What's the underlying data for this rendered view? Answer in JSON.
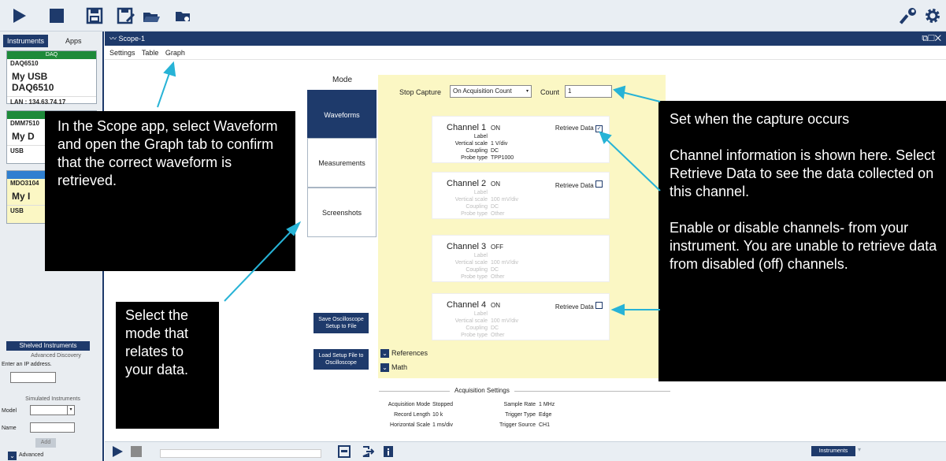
{
  "toolbar": {
    "icons": [
      "run-icon",
      "stop-icon",
      "save-icon",
      "save-as-icon",
      "open-icon",
      "open-folder-icon",
      "wrench-icon",
      "settings-gear-icon"
    ]
  },
  "sidebar": {
    "tabs": [
      "Instruments",
      "Apps"
    ],
    "cards": [
      {
        "strip": "DAQ",
        "model": "DAQ6510",
        "name": "My USB DAQ6510",
        "lan": "LAN : 134.63.74.17",
        "color": "#1e8a3a"
      },
      {
        "strip": "",
        "model": "DMM7510",
        "name": "My D",
        "lan": "USB",
        "color": "#1e8a3a"
      },
      {
        "strip": "D",
        "model": "MDO3104",
        "name": "My I",
        "lan": "USB",
        "color": "#2f7fd0"
      }
    ],
    "shelved_label": "Shelved Instruments",
    "advanced_discovery": "Advanced Discovery",
    "ip_prompt": "Enter an IP address.",
    "simulated": "Simulated Instruments",
    "model_label": "Model",
    "name_label": "Name",
    "add_label": "Add",
    "advanced_label": "Advanced"
  },
  "window": {
    "title": "Scope-1",
    "tabs": [
      "Settings",
      "Table",
      "Graph"
    ]
  },
  "mode": {
    "heading": "Mode",
    "buttons": [
      "Waveforms",
      "Measurements",
      "Screenshots"
    ],
    "active": "Waveforms"
  },
  "capture": {
    "stop_label": "Stop Capture",
    "stop_value": "On Acquisition Count",
    "count_label": "Count",
    "count_value": "1"
  },
  "channels": [
    {
      "name": "Channel 1",
      "state": "ON",
      "retrieve": "Retrieve Data",
      "checked": true,
      "label": "",
      "vscale": "1 V/div",
      "coupling": "DC",
      "probe": "TPP1000",
      "dim": false
    },
    {
      "name": "Channel 2",
      "state": "ON",
      "retrieve": "Retrieve Data",
      "checked": false,
      "label": "",
      "vscale": "100 mV/div",
      "coupling": "DC",
      "probe": "Other",
      "dim": true
    },
    {
      "name": "Channel 3",
      "state": "OFF",
      "retrieve": "",
      "checked": false,
      "label": "",
      "vscale": "100 mV/div",
      "coupling": "DC",
      "probe": "Other",
      "dim": true
    },
    {
      "name": "Channel 4",
      "state": "ON",
      "retrieve": "Retrieve Data",
      "checked": false,
      "label": "",
      "vscale": "100 mV/div",
      "coupling": "DC",
      "probe": "Other",
      "dim": true
    }
  ],
  "field_labels": {
    "label": "Label",
    "vscale": "Vertical scale",
    "coupling": "Coupling",
    "probe": "Probe type"
  },
  "setup_buttons": {
    "save": "Save Oscilloscope Setup to File",
    "load": "Load Setup File to Oscilloscope"
  },
  "toggles": {
    "references": "References",
    "math": "Math"
  },
  "acquisition": {
    "heading": "Acquisition Settings",
    "mode_label": "Acquisition Mode",
    "mode_value": "Stopped",
    "length_label": "Record Length",
    "length_value": "10 k",
    "hscale_label": "Horizontal Scale",
    "hscale_value": "1 ms/div",
    "rate_label": "Sample Rate",
    "rate_value": "1 MHz",
    "ttype_label": "Trigger Type",
    "ttype_value": "Edge",
    "tsource_label": "Trigger Source",
    "tsource_value": "CH1"
  },
  "bottom": {
    "instruments_button": "Instruments"
  },
  "callouts": {
    "left": "In the Scope app, select Waveform and open the Graph tab to confirm that the correct waveform is retrieved.",
    "mode": "Select the mode that relates to your data.",
    "r1": "Set when the capture occurs",
    "r2": "Channel information is shown here. Select Retrieve Data to see the data collected on this channel.",
    "r3": "Enable or disable channels- from your instrument. You are unable to retrieve data from disabled (off) channels."
  },
  "colors": {
    "navy": "#1e3a6b",
    "yellow": "#fbf7c4",
    "arrow": "#27b3d6"
  }
}
